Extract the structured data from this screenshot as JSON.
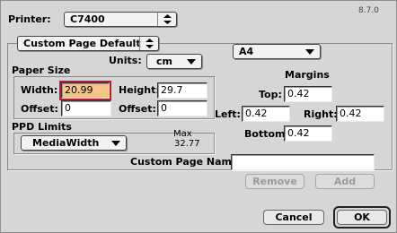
{
  "version": "8.7.0",
  "printer": {
    "label": "Printer:",
    "value": "C7400"
  },
  "page_preset": {
    "value": "Custom Page Default"
  },
  "paper_size_menu": {
    "value": "A4"
  },
  "units": {
    "label": "Units:",
    "value": "cm"
  },
  "paper_size": {
    "title": "Paper Size",
    "width_label": "Width:",
    "width_value": "20.99",
    "height_label": "Height:",
    "height_value": "29.7",
    "offset1_label": "Offset:",
    "offset1_value": "0",
    "offset2_label": "Offset:",
    "offset2_value": "0"
  },
  "margins": {
    "title": "Margins",
    "top_label": "Top:",
    "top_value": "0.42",
    "left_label": "Left:",
    "left_value": "0.42",
    "right_label": "Right:",
    "right_value": "0.42",
    "bottom_label": "Bottom:",
    "bottom_value": "0.42"
  },
  "ppd_limits": {
    "title": "PPD Limits",
    "select_value": "MediaWidth",
    "max_label": "Max",
    "max_value": "32.77"
  },
  "custom_page_name": {
    "label": "Custom Page Name",
    "value": ""
  },
  "buttons": {
    "remove": "Remove",
    "add": "Add",
    "cancel": "Cancel",
    "ok": "OK"
  }
}
